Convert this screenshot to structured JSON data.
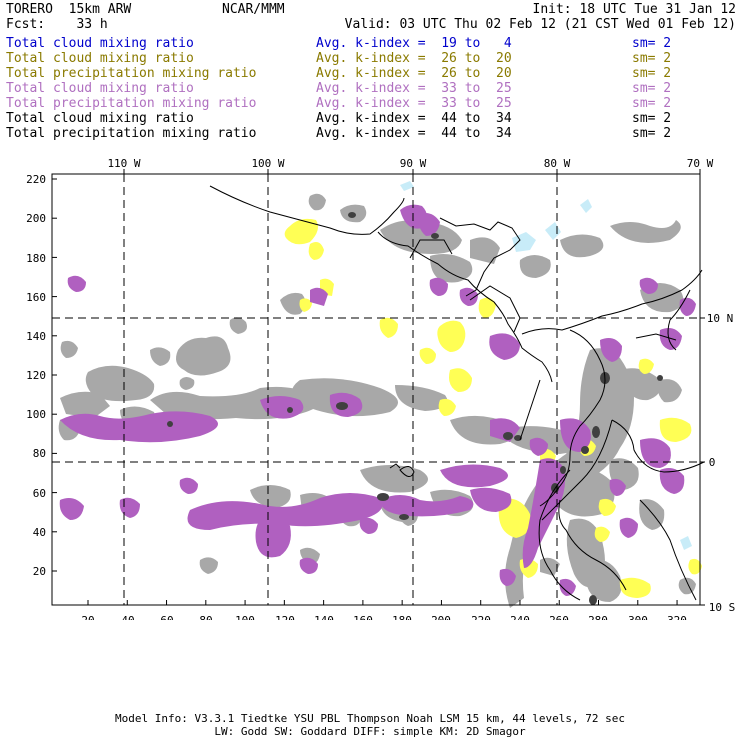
{
  "header": {
    "model": "TORERO  15km ARW",
    "org": "NCAR/MMM",
    "init": "Init: 18 UTC Tue 31 Jan 12",
    "fcst": "Fcst:    33 h",
    "valid": "Valid: 03 UTC Thu 02 Feb 12 (21 CST Wed 01 Feb 12)"
  },
  "legend": [
    {
      "desc": "Total cloud mixing ratio",
      "avg": "Avg. k-index =  19 to   4",
      "sm": "sm= 2",
      "color": "#0000cc"
    },
    {
      "desc": "Total cloud mixing ratio",
      "avg": "Avg. k-index =  26 to  20",
      "sm": "sm= 2",
      "color": "#8a7a00"
    },
    {
      "desc": "Total precipitation mixing ratio",
      "avg": "Avg. k-index =  26 to  20",
      "sm": "sm= 2",
      "color": "#8a7a00"
    },
    {
      "desc": "Total cloud mixing ratio",
      "avg": "Avg. k-index =  33 to  25",
      "sm": "sm= 2",
      "color": "#b070c0"
    },
    {
      "desc": "Total precipitation mixing ratio",
      "avg": "Avg. k-index =  33 to  25",
      "sm": "sm= 2",
      "color": "#b070c0"
    },
    {
      "desc": "Total cloud mixing ratio",
      "avg": "Avg. k-index =  44 to  34",
      "sm": "sm= 2",
      "color": "#000000"
    },
    {
      "desc": "Total precipitation mixing ratio",
      "avg": "Avg. k-index =  44 to  34",
      "sm": "sm= 2",
      "color": "#000000"
    }
  ],
  "map": {
    "lon_labels": [
      "110 W",
      "100 W",
      "90 W",
      "80 W",
      "70 W"
    ],
    "lat_labels": [
      "10 N",
      "0",
      "10 S"
    ],
    "x_ticks": [
      "20",
      "40",
      "60",
      "80",
      "100",
      "120",
      "140",
      "160",
      "180",
      "200",
      "220",
      "240",
      "260",
      "280",
      "300",
      "320"
    ],
    "y_ticks": [
      "20",
      "40",
      "60",
      "80",
      "100",
      "120",
      "140",
      "160",
      "180",
      "200",
      "220"
    ],
    "colors": {
      "cloud_gray": "#a8a8a8",
      "dark_core": "#404040",
      "yellow": "#ffff55",
      "purple": "#b060c0",
      "cyan": "#c8ecf8"
    }
  },
  "footer": {
    "line1": "Model Info: V3.3.1   Tiedtke YSU PBL  Thompson     Noah LSM  15 km,   44 levels,   72 sec",
    "line2": "LW: Godd SW: Goddard DIFF: simple KM: 2D Smagor"
  }
}
